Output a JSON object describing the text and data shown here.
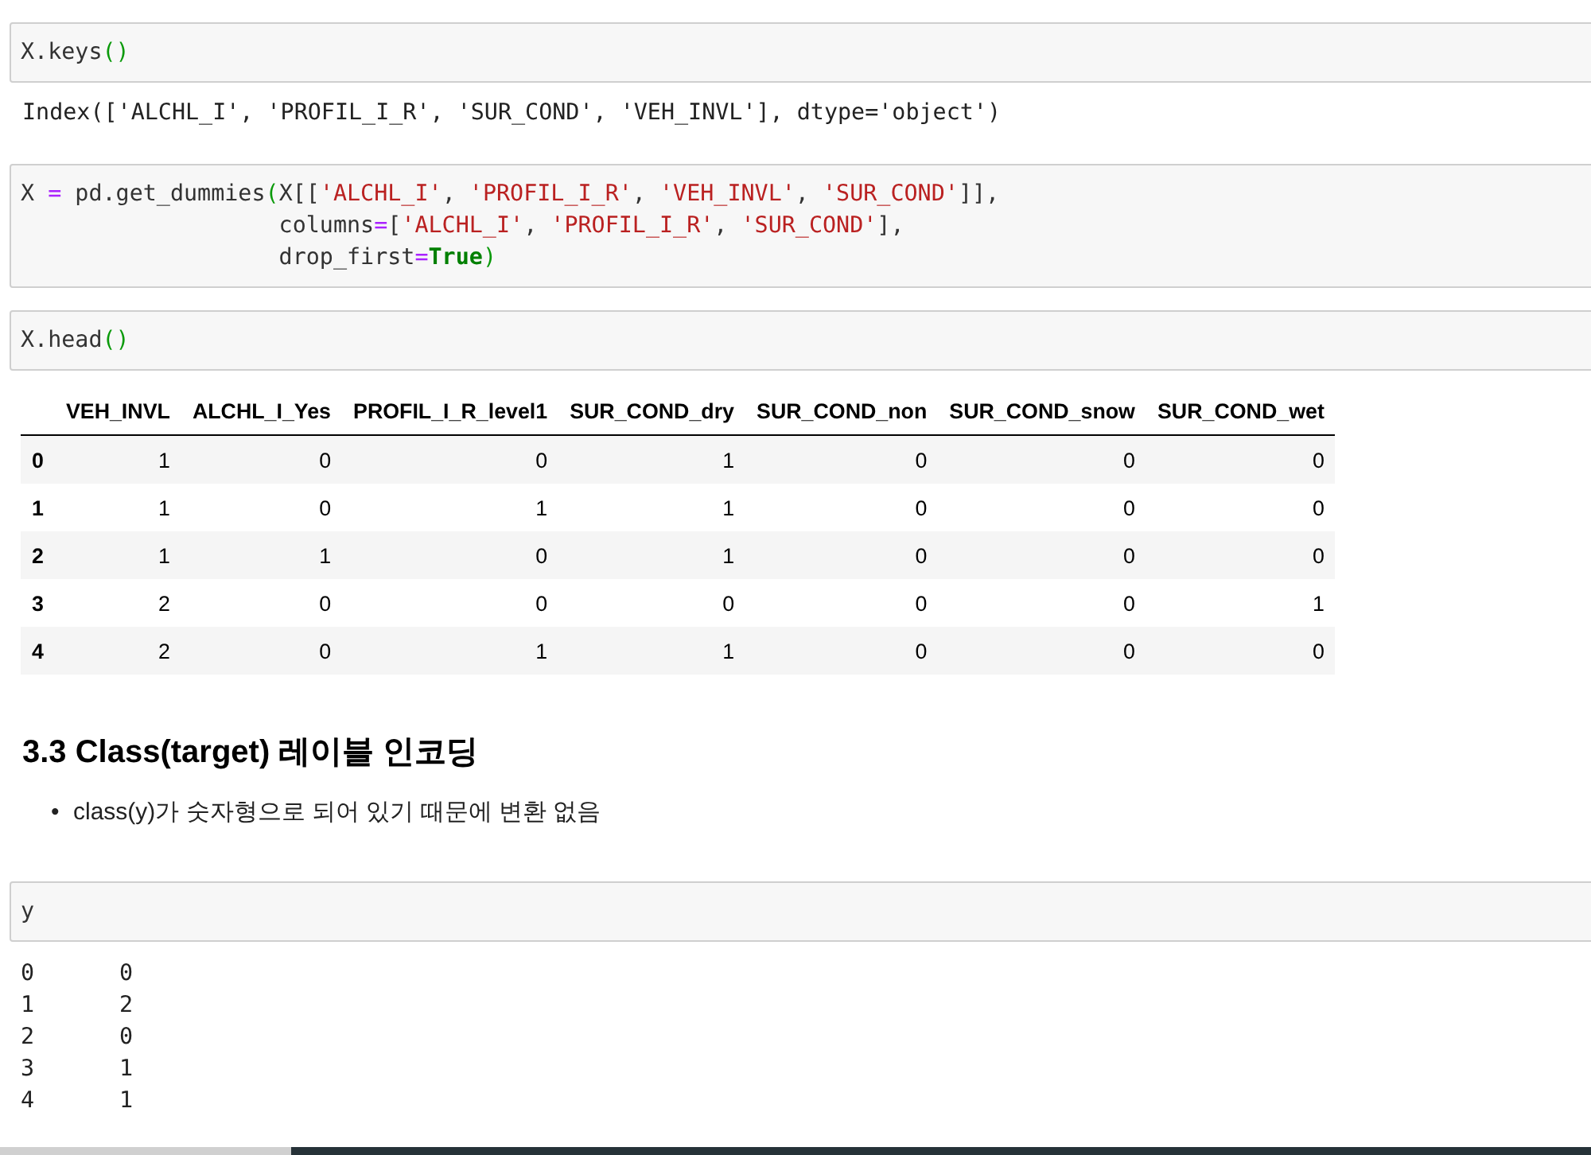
{
  "cells": [
    {
      "kind": "code",
      "lines": [
        [
          {
            "t": "X.keys",
            "kind": "plain"
          },
          {
            "t": "()",
            "kind": "paren"
          }
        ]
      ],
      "output": {
        "kind": "text",
        "text": "Index(['ALCHL_I', 'PROFIL_I_R', 'SUR_COND', 'VEH_INVL'], dtype='object')"
      }
    },
    {
      "kind": "code",
      "lines": [
        [
          {
            "t": "X ",
            "kind": "plain"
          },
          {
            "t": "=",
            "kind": "op"
          },
          {
            "t": " pd.get_dummies",
            "kind": "plain"
          },
          {
            "t": "(",
            "kind": "paren"
          },
          {
            "t": "X[[",
            "kind": "plain"
          },
          {
            "t": "'ALCHL_I'",
            "kind": "string"
          },
          {
            "t": ", ",
            "kind": "plain"
          },
          {
            "t": "'PROFIL_I_R'",
            "kind": "string"
          },
          {
            "t": ", ",
            "kind": "plain"
          },
          {
            "t": "'VEH_INVL'",
            "kind": "string"
          },
          {
            "t": ", ",
            "kind": "plain"
          },
          {
            "t": "'SUR_COND'",
            "kind": "string"
          },
          {
            "t": "]],",
            "kind": "plain"
          }
        ],
        [
          {
            "t": "                   columns",
            "kind": "plain"
          },
          {
            "t": "=",
            "kind": "op"
          },
          {
            "t": "[",
            "kind": "plain"
          },
          {
            "t": "'ALCHL_I'",
            "kind": "string"
          },
          {
            "t": ", ",
            "kind": "plain"
          },
          {
            "t": "'PROFIL_I_R'",
            "kind": "string"
          },
          {
            "t": ", ",
            "kind": "plain"
          },
          {
            "t": "'SUR_COND'",
            "kind": "string"
          },
          {
            "t": "],",
            "kind": "plain"
          }
        ],
        [
          {
            "t": "                   drop_first",
            "kind": "plain"
          },
          {
            "t": "=",
            "kind": "op"
          },
          {
            "t": "True",
            "kind": "keyword"
          },
          {
            "t": ")",
            "kind": "paren"
          }
        ]
      ]
    },
    {
      "kind": "code",
      "lines": [
        [
          {
            "t": "X.head",
            "kind": "plain"
          },
          {
            "t": "()",
            "kind": "paren"
          }
        ]
      ],
      "output": {
        "kind": "table",
        "columns": [
          "",
          "VEH_INVL",
          "ALCHL_I_Yes",
          "PROFIL_I_R_level1",
          "SUR_COND_dry",
          "SUR_COND_non",
          "SUR_COND_snow",
          "SUR_COND_wet"
        ],
        "rows": [
          [
            "0",
            "1",
            "0",
            "0",
            "1",
            "0",
            "0",
            "0"
          ],
          [
            "1",
            "1",
            "0",
            "1",
            "1",
            "0",
            "0",
            "0"
          ],
          [
            "2",
            "1",
            "1",
            "0",
            "1",
            "0",
            "0",
            "0"
          ],
          [
            "3",
            "2",
            "0",
            "0",
            "0",
            "0",
            "0",
            "1"
          ],
          [
            "4",
            "2",
            "0",
            "1",
            "1",
            "0",
            "0",
            "0"
          ]
        ]
      }
    },
    {
      "kind": "markdown",
      "heading": "3.3 Class(target) 레이블 인코딩",
      "bullets": [
        {
          "marker": "•",
          "text": "class(y)가 숫자형으로 되어 있기 때문에 변환 없음"
        }
      ]
    },
    {
      "kind": "code",
      "lines": [
        [
          {
            "t": "y",
            "kind": "plain"
          }
        ]
      ],
      "output": {
        "kind": "series",
        "rows": [
          [
            "0",
            "0"
          ],
          [
            "1",
            "2"
          ],
          [
            "2",
            "0"
          ],
          [
            "3",
            "1"
          ],
          [
            "4",
            "1"
          ]
        ]
      }
    }
  ]
}
